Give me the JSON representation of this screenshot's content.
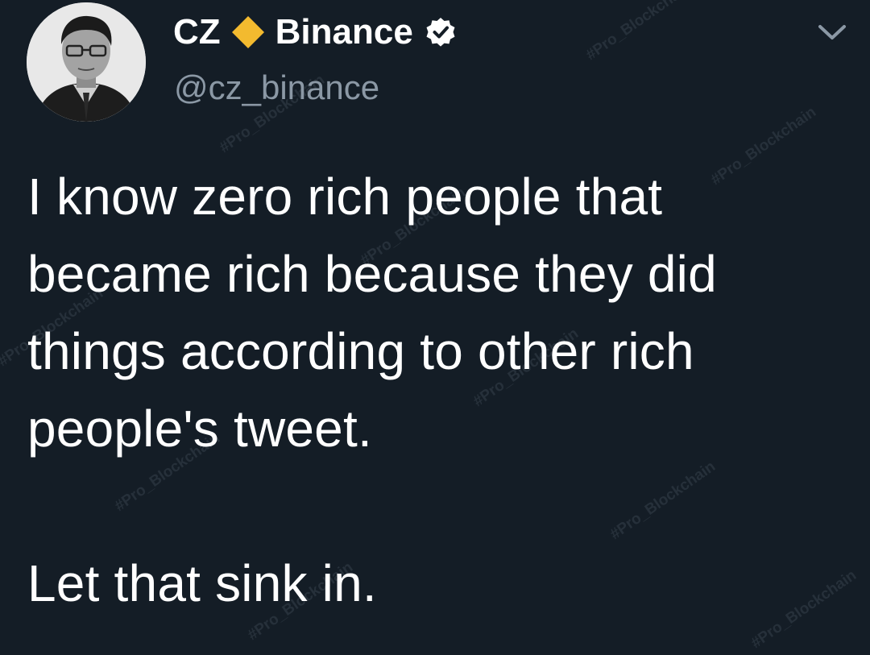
{
  "header": {
    "name": "CZ",
    "org": "Binance",
    "handle": "@cz_binance",
    "diamond_color": "#f3ba2f",
    "verified_color": "#ffffff"
  },
  "tweet": {
    "lines": [
      "I know zero rich people that",
      "became rich because they did",
      "things according to other rich",
      "people's tweet."
    ],
    "closing": "Let that sink in."
  },
  "watermark": {
    "text": "#Pro_Blockchain"
  },
  "icons": {
    "diamond": "diamond-icon",
    "verified": "verified-badge-icon",
    "menu": "chevron-down-icon"
  }
}
